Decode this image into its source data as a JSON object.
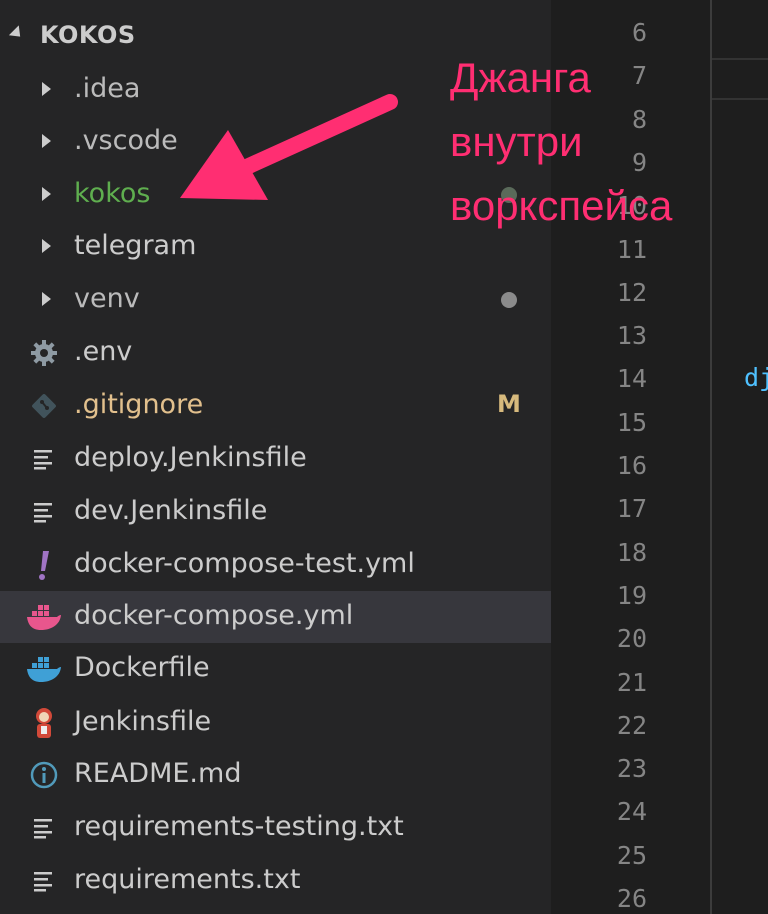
{
  "explorer": {
    "folder_title": "KOKOS",
    "items": [
      {
        "label": ".idea",
        "kind": "folder"
      },
      {
        "label": ".vscode",
        "kind": "folder"
      },
      {
        "label": "kokos",
        "kind": "folder"
      },
      {
        "label": "telegram",
        "kind": "folder"
      },
      {
        "label": "venv",
        "kind": "folder"
      },
      {
        "label": ".env",
        "kind": "file",
        "icon": "gear-icon"
      },
      {
        "label": ".gitignore",
        "kind": "file",
        "icon": "git-icon",
        "status": "M"
      },
      {
        "label": "deploy.Jenkinsfile",
        "kind": "file",
        "icon": "lines-icon"
      },
      {
        "label": "dev.Jenkinsfile",
        "kind": "file",
        "icon": "lines-icon"
      },
      {
        "label": "docker-compose-test.yml",
        "kind": "file",
        "icon": "exclamation-icon"
      },
      {
        "label": "docker-compose.yml",
        "kind": "file",
        "icon": "docker-icon"
      },
      {
        "label": "Dockerfile",
        "kind": "file",
        "icon": "docker-icon"
      },
      {
        "label": "Jenkinsfile",
        "kind": "file",
        "icon": "jenkins-icon"
      },
      {
        "label": "README.md",
        "kind": "file",
        "icon": "info-icon"
      },
      {
        "label": "requirements-testing.txt",
        "kind": "file",
        "icon": "lines-icon"
      },
      {
        "label": "requirements.txt",
        "kind": "file",
        "icon": "lines-icon"
      }
    ]
  },
  "editor": {
    "line_numbers": [
      "6",
      "7",
      "8",
      "9",
      "10",
      "11",
      "12",
      "13",
      "14",
      "15",
      "16",
      "17",
      "18",
      "19",
      "20",
      "21",
      "22",
      "23",
      "24",
      "25",
      "26"
    ],
    "code_fragment": "dj"
  },
  "annotation": {
    "line1": "Джанга",
    "line2": "внутри",
    "line3": "воркспейса"
  },
  "colors": {
    "annotation": "#ff2e72",
    "modified": "#e2c08d",
    "folder_green": "#5fae4f",
    "docker_pink": "#e8568d",
    "docker_blue": "#3fa0d6"
  }
}
